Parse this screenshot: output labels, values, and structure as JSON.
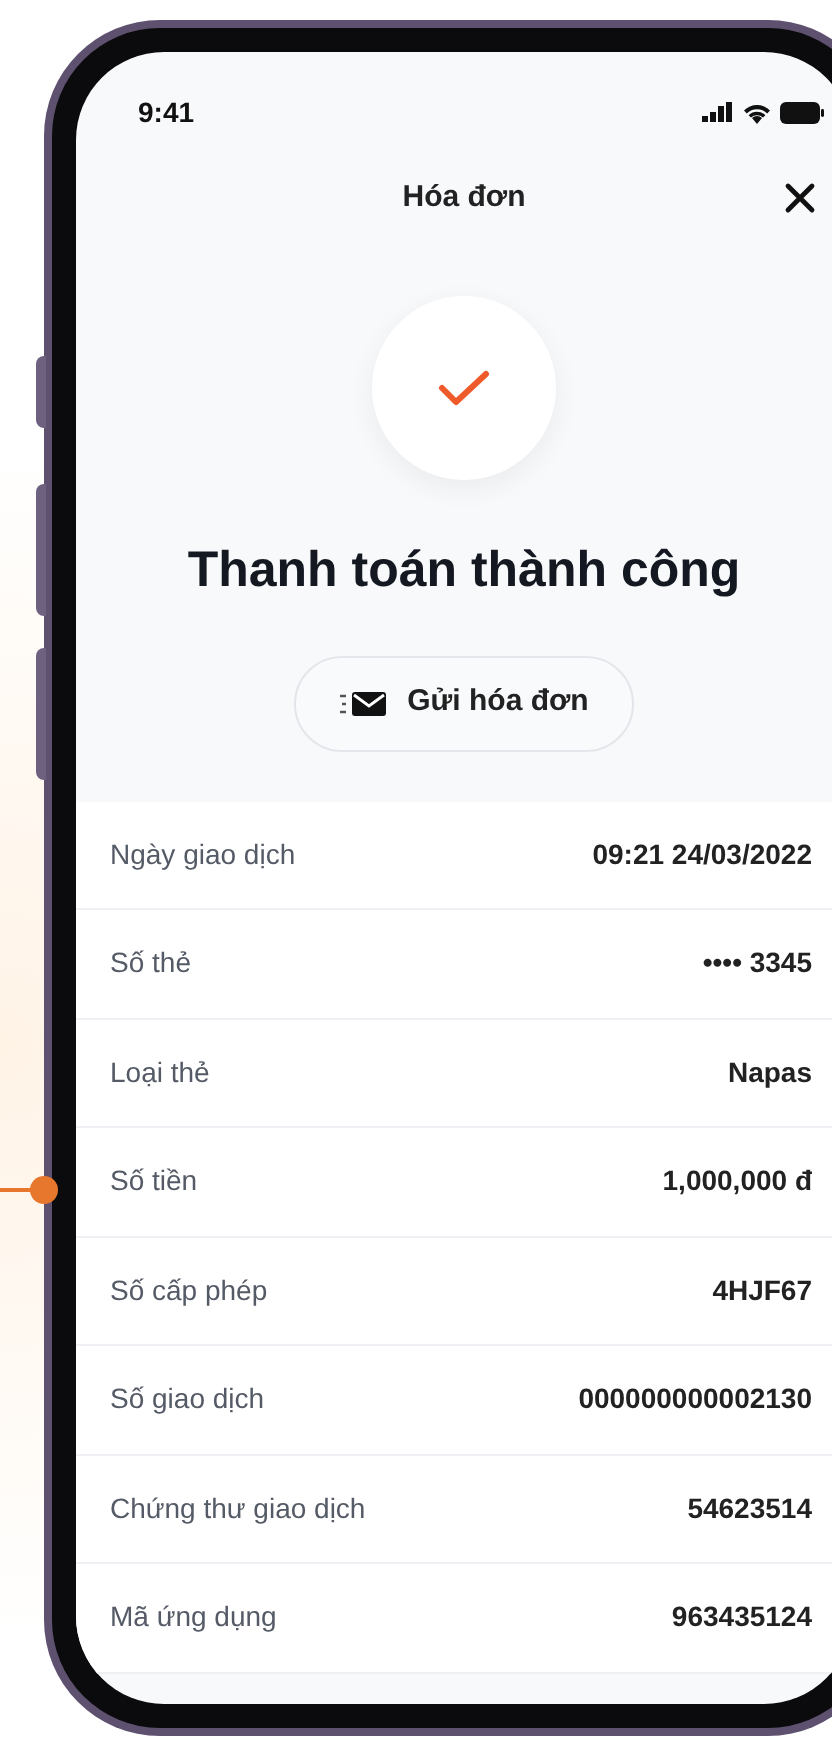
{
  "status_bar": {
    "time": "9:41"
  },
  "header": {
    "title": "Hóa đơn"
  },
  "result": {
    "title": "Thanh toán thành công",
    "button": "Gửi hóa đơn"
  },
  "details": [
    {
      "label": "Ngày giao dịch",
      "value": "09:21 24/03/2022"
    },
    {
      "label": "Số thẻ",
      "value": "•••• 3345"
    },
    {
      "label": "Loại thẻ",
      "value": "Napas"
    },
    {
      "label": "Số tiền",
      "value": "1,000,000 đ"
    },
    {
      "label": "Số cấp phép",
      "value": "4HJF67"
    },
    {
      "label": "Số giao dịch",
      "value": "000000000002130"
    },
    {
      "label": "Chứng thư giao dịch",
      "value": "54623514"
    },
    {
      "label": "Mã ứng dụng",
      "value": "963435124"
    }
  ]
}
